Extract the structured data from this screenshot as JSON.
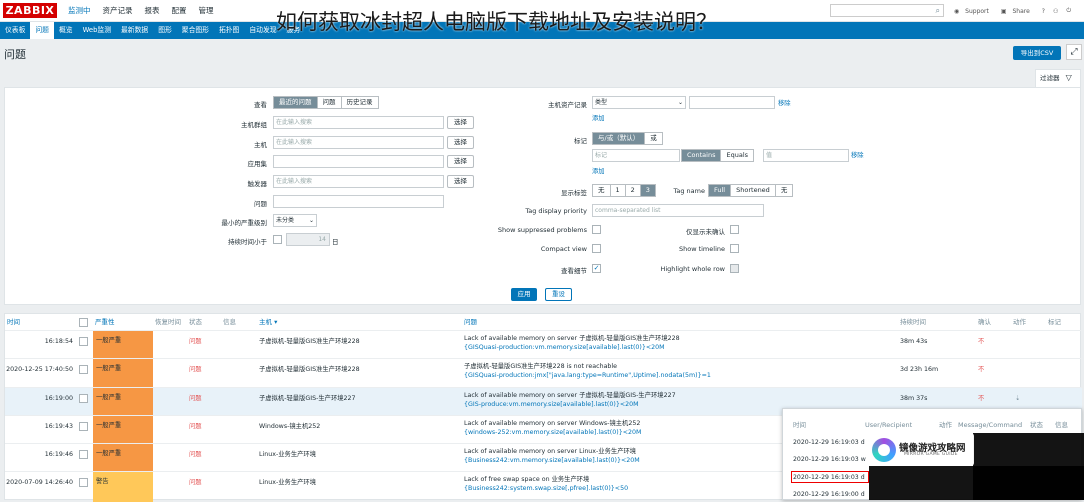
{
  "app": {
    "logo": "ZABBIX"
  },
  "overlay_title": "如何获取冰封超人电脑版下载地址及安装说明？",
  "main_menu": [
    {
      "label": "监测中",
      "selected": true
    },
    {
      "label": "资产记录"
    },
    {
      "label": "报表"
    },
    {
      "label": "配置"
    },
    {
      "label": "管理"
    }
  ],
  "top_links": {
    "support": "Support",
    "share": "Share",
    "help": "?",
    "user": "⚇",
    "logout": "⏻"
  },
  "sub_menu": [
    {
      "label": "仪表板"
    },
    {
      "label": "问题",
      "selected": true
    },
    {
      "label": "概览"
    },
    {
      "label": "Web监测"
    },
    {
      "label": "最新数据"
    },
    {
      "label": "图形"
    },
    {
      "label": "聚合图形"
    },
    {
      "label": "拓扑图"
    },
    {
      "label": "自动发现"
    },
    {
      "label": "服务"
    }
  ],
  "page": {
    "title": "问题",
    "export_label": "导出到CSV",
    "expand_icon": "⤢",
    "filter_tab_label": "过滤器"
  },
  "filter": {
    "show_label": "查看",
    "show_options": [
      "最近的问题",
      "问题",
      "历史记录"
    ],
    "hostgroup_label": "主机群组",
    "host_label": "主机",
    "appl_label": "应用集",
    "trigger_label": "触发器",
    "problem_label": "问题",
    "severity_label": "最小的严重级别",
    "severity_value": "未分类",
    "age_label": "持续时间小于",
    "age_value": "14",
    "age_unit": "日",
    "placeholder_search": "在此输入搜索",
    "select_label": "选择",
    "inventory_label": "主机资产记录",
    "inventory_field": "类型",
    "remove_label": "移除",
    "add_label": "添加",
    "tags_label": "标记",
    "tags_eval": [
      "与/或（默认）",
      "或"
    ],
    "tag_placeholder": "标记",
    "tag_operators": [
      "Contains",
      "Equals"
    ],
    "tag_value_placeholder": "值",
    "show_tags_label": "显示标签",
    "show_tags_options": [
      "无",
      "1",
      "2",
      "3"
    ],
    "tag_name_label": "Tag name",
    "tag_name_options": [
      "Full",
      "Shortened",
      "无"
    ],
    "tag_priority_label": "Tag display priority",
    "tag_priority_placeholder": "comma-separated list",
    "suppressed_label": "Show suppressed problems",
    "unack_label": "仅显示未确认",
    "compact_label": "Compact view",
    "timeline_label": "Show timeline",
    "details_label": "查看细节",
    "highlight_label": "Highlight whole row",
    "apply_label": "应用",
    "reset_label": "重设"
  },
  "table": {
    "headers": {
      "time": "时间",
      "severity": "严重性",
      "recovery": "恢复时间",
      "status": "状态",
      "info": "信息",
      "host": "主机 ▾",
      "problem": "问题",
      "duration": "持续时间",
      "ack": "确认",
      "actions": "动作",
      "tags": "标记"
    },
    "rows": [
      {
        "time": "16:18:54",
        "severity": "一般严重",
        "sev_class": "high",
        "status": "问题",
        "host": "子虚拟机-轻量版GIS准生产环境228",
        "problem": "Lack of available memory on server 子虚拟机-轻量版GIS准生产环境228",
        "expr": "{GISQuasi-production:vm.memory.size[available].last(0)}<20M",
        "duration": "38m 43s",
        "ack": "不",
        "actions": ""
      },
      {
        "time": "2020-12-25 17:40:50",
        "severity": "一般严重",
        "sev_class": "high",
        "status": "问题",
        "host": "子虚拟机-轻量版GIS准生产环境228",
        "problem": "子虚拟机-轻量版GIS准生产环境228 is not reachable",
        "expr": "{GISQuasi-production:jmx[\"java.lang:type=Runtime\",Uptime].nodata(5m)}=1",
        "duration": "3d 23h 16m",
        "ack": "不",
        "actions": ""
      },
      {
        "time": "16:19:00",
        "severity": "一般严重",
        "sev_class": "high",
        "status": "问题",
        "host": "子虚拟机-轻量版GIS-生产环境227",
        "problem": "Lack of available memory on server 子虚拟机-轻量版GIS-生产环境227",
        "expr": "{GIS-produce:vm.memory.size[available].last(0)}<20M",
        "duration": "38m 37s",
        "ack": "不",
        "actions": "⇣"
      },
      {
        "time": "16:19:43",
        "severity": "一般严重",
        "sev_class": "high",
        "status": "问题",
        "host": "Windows-镜主机252",
        "problem": "Lack of available memory on server Windows-镜主机252",
        "expr": "{windows-252:vm.memory.size[available].last(0)}<20M",
        "duration": "",
        "ack": "",
        "actions": ""
      },
      {
        "time": "16:19:46",
        "severity": "一般严重",
        "sev_class": "high",
        "status": "问题",
        "host": "Linux-业务生产环境",
        "problem": "Lack of available memory on server Linux-业务生产环境",
        "expr": "{Business242:vm.memory.size[available].last(0)}<20M",
        "duration": "",
        "ack": "",
        "actions": ""
      },
      {
        "time": "2020-07-09 14:26:40",
        "severity": "警告",
        "sev_class": "warn",
        "status": "问题",
        "host": "Linux-业务生产环境",
        "problem": "Lack of free swap space on 业务生产环境",
        "expr": "{Business242:system.swap.size[,pfree].last(0)}<50",
        "duration": "",
        "ack": "",
        "actions": ""
      }
    ]
  },
  "notification": {
    "headers": {
      "time": "时间",
      "user": "User/Recipient",
      "action": "动作",
      "message": "Message/Command",
      "status": "状态",
      "info": "信息"
    },
    "rows": [
      {
        "time": "2020-12-29 16:19:03",
        "suffix": "d"
      },
      {
        "time": "2020-12-29 16:19:03",
        "suffix": "w"
      },
      {
        "time": "2020-12-29 16:19:03",
        "suffix": "d"
      },
      {
        "time": "2020-12-29 16:19:00",
        "suffix": "d"
      }
    ]
  },
  "watermark": {
    "title": "镜像游戏攻略网",
    "subtitle": "MIRROR GAME GUIDE"
  }
}
